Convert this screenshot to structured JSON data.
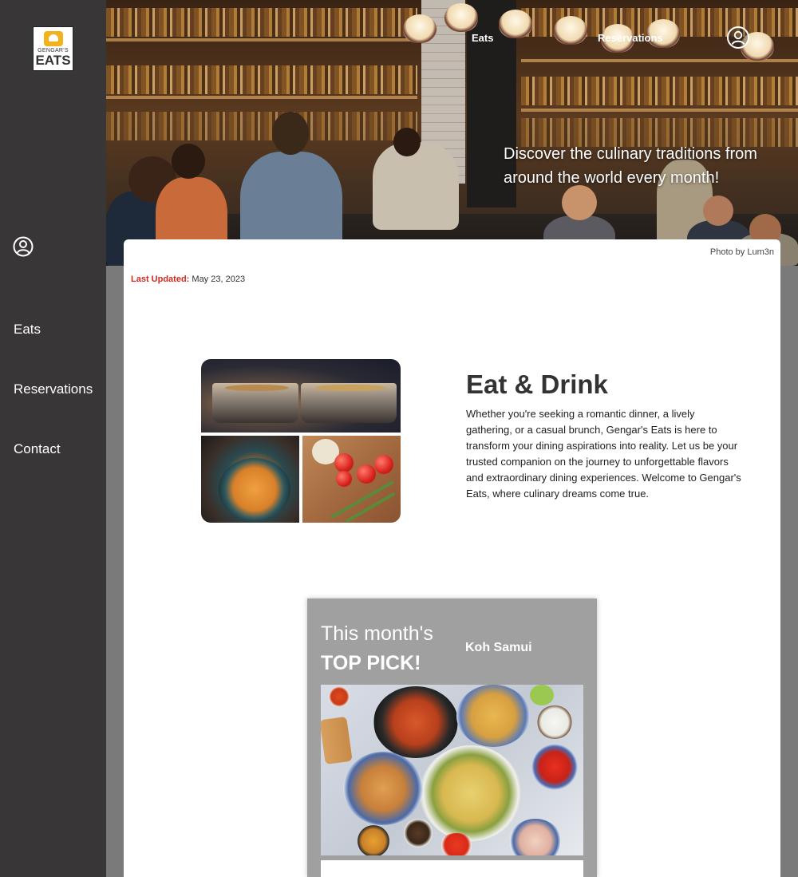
{
  "brand": {
    "logo_line1": "GENGAR'S",
    "logo_line2": "EATS"
  },
  "sidebar": {
    "items": [
      {
        "label": "Eats"
      },
      {
        "label": "Reservations"
      },
      {
        "label": "Contact"
      }
    ]
  },
  "header": {
    "nav": [
      {
        "label": "Eats"
      },
      {
        "label": "Reservations"
      }
    ],
    "tagline": "Discover the culinary traditions from around the world every month!",
    "photo_credit": "Photo by Lum3n"
  },
  "meta": {
    "updated_label": "Last Updated:",
    "updated_value": "May 23, 2023"
  },
  "intro": {
    "title": "Eat & Drink",
    "body": "Whether you're seeking a romantic dinner, a lively gathering, or a casual brunch, Gengar's Eats is here to transform your dining aspirations into reality. Let us be your trusted companion on the journey to unforgettable flavors and extraordinary dining experiences. Welcome to Gengar's Eats, where culinary dreams come true."
  },
  "top_pick": {
    "line1": "This month's",
    "line2": "TOP PICK!",
    "name": "Koh Samui"
  },
  "colors": {
    "sidebar": "#383637",
    "accent_red": "#d12a1f",
    "logo_yellow": "#f2b21b",
    "page_bg": "#7a7a7a"
  }
}
